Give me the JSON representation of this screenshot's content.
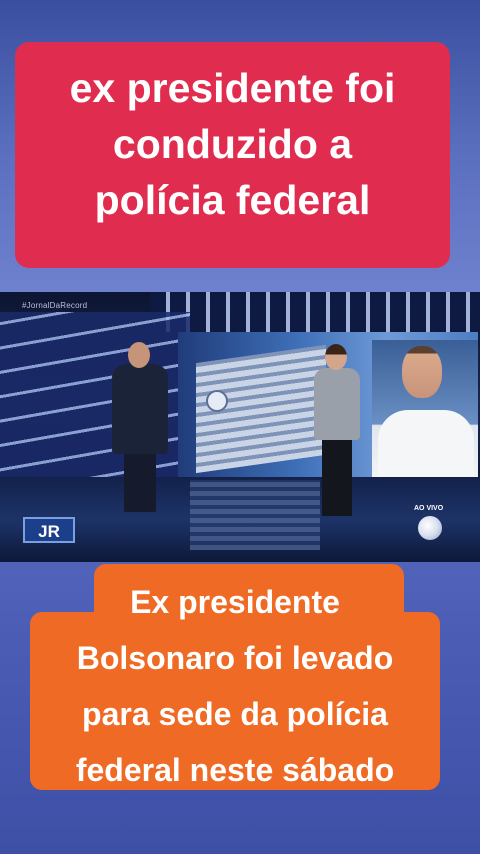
{
  "top_caption": {
    "line1": "ex presidente foi",
    "line2": "conduzido a",
    "line3": "polícia federal",
    "bg_color": "#e02d4f"
  },
  "video": {
    "hashtag": "#JornalDaRecord",
    "logo_text": "JR",
    "live_label": "AO VIVO"
  },
  "bottom_caption": {
    "line1": "Ex presidente",
    "line2": "Bolsonaro foi levado",
    "line3": "para sede da polícia",
    "line4": "federal neste sábado",
    "bg_color": "#ef6a24"
  }
}
